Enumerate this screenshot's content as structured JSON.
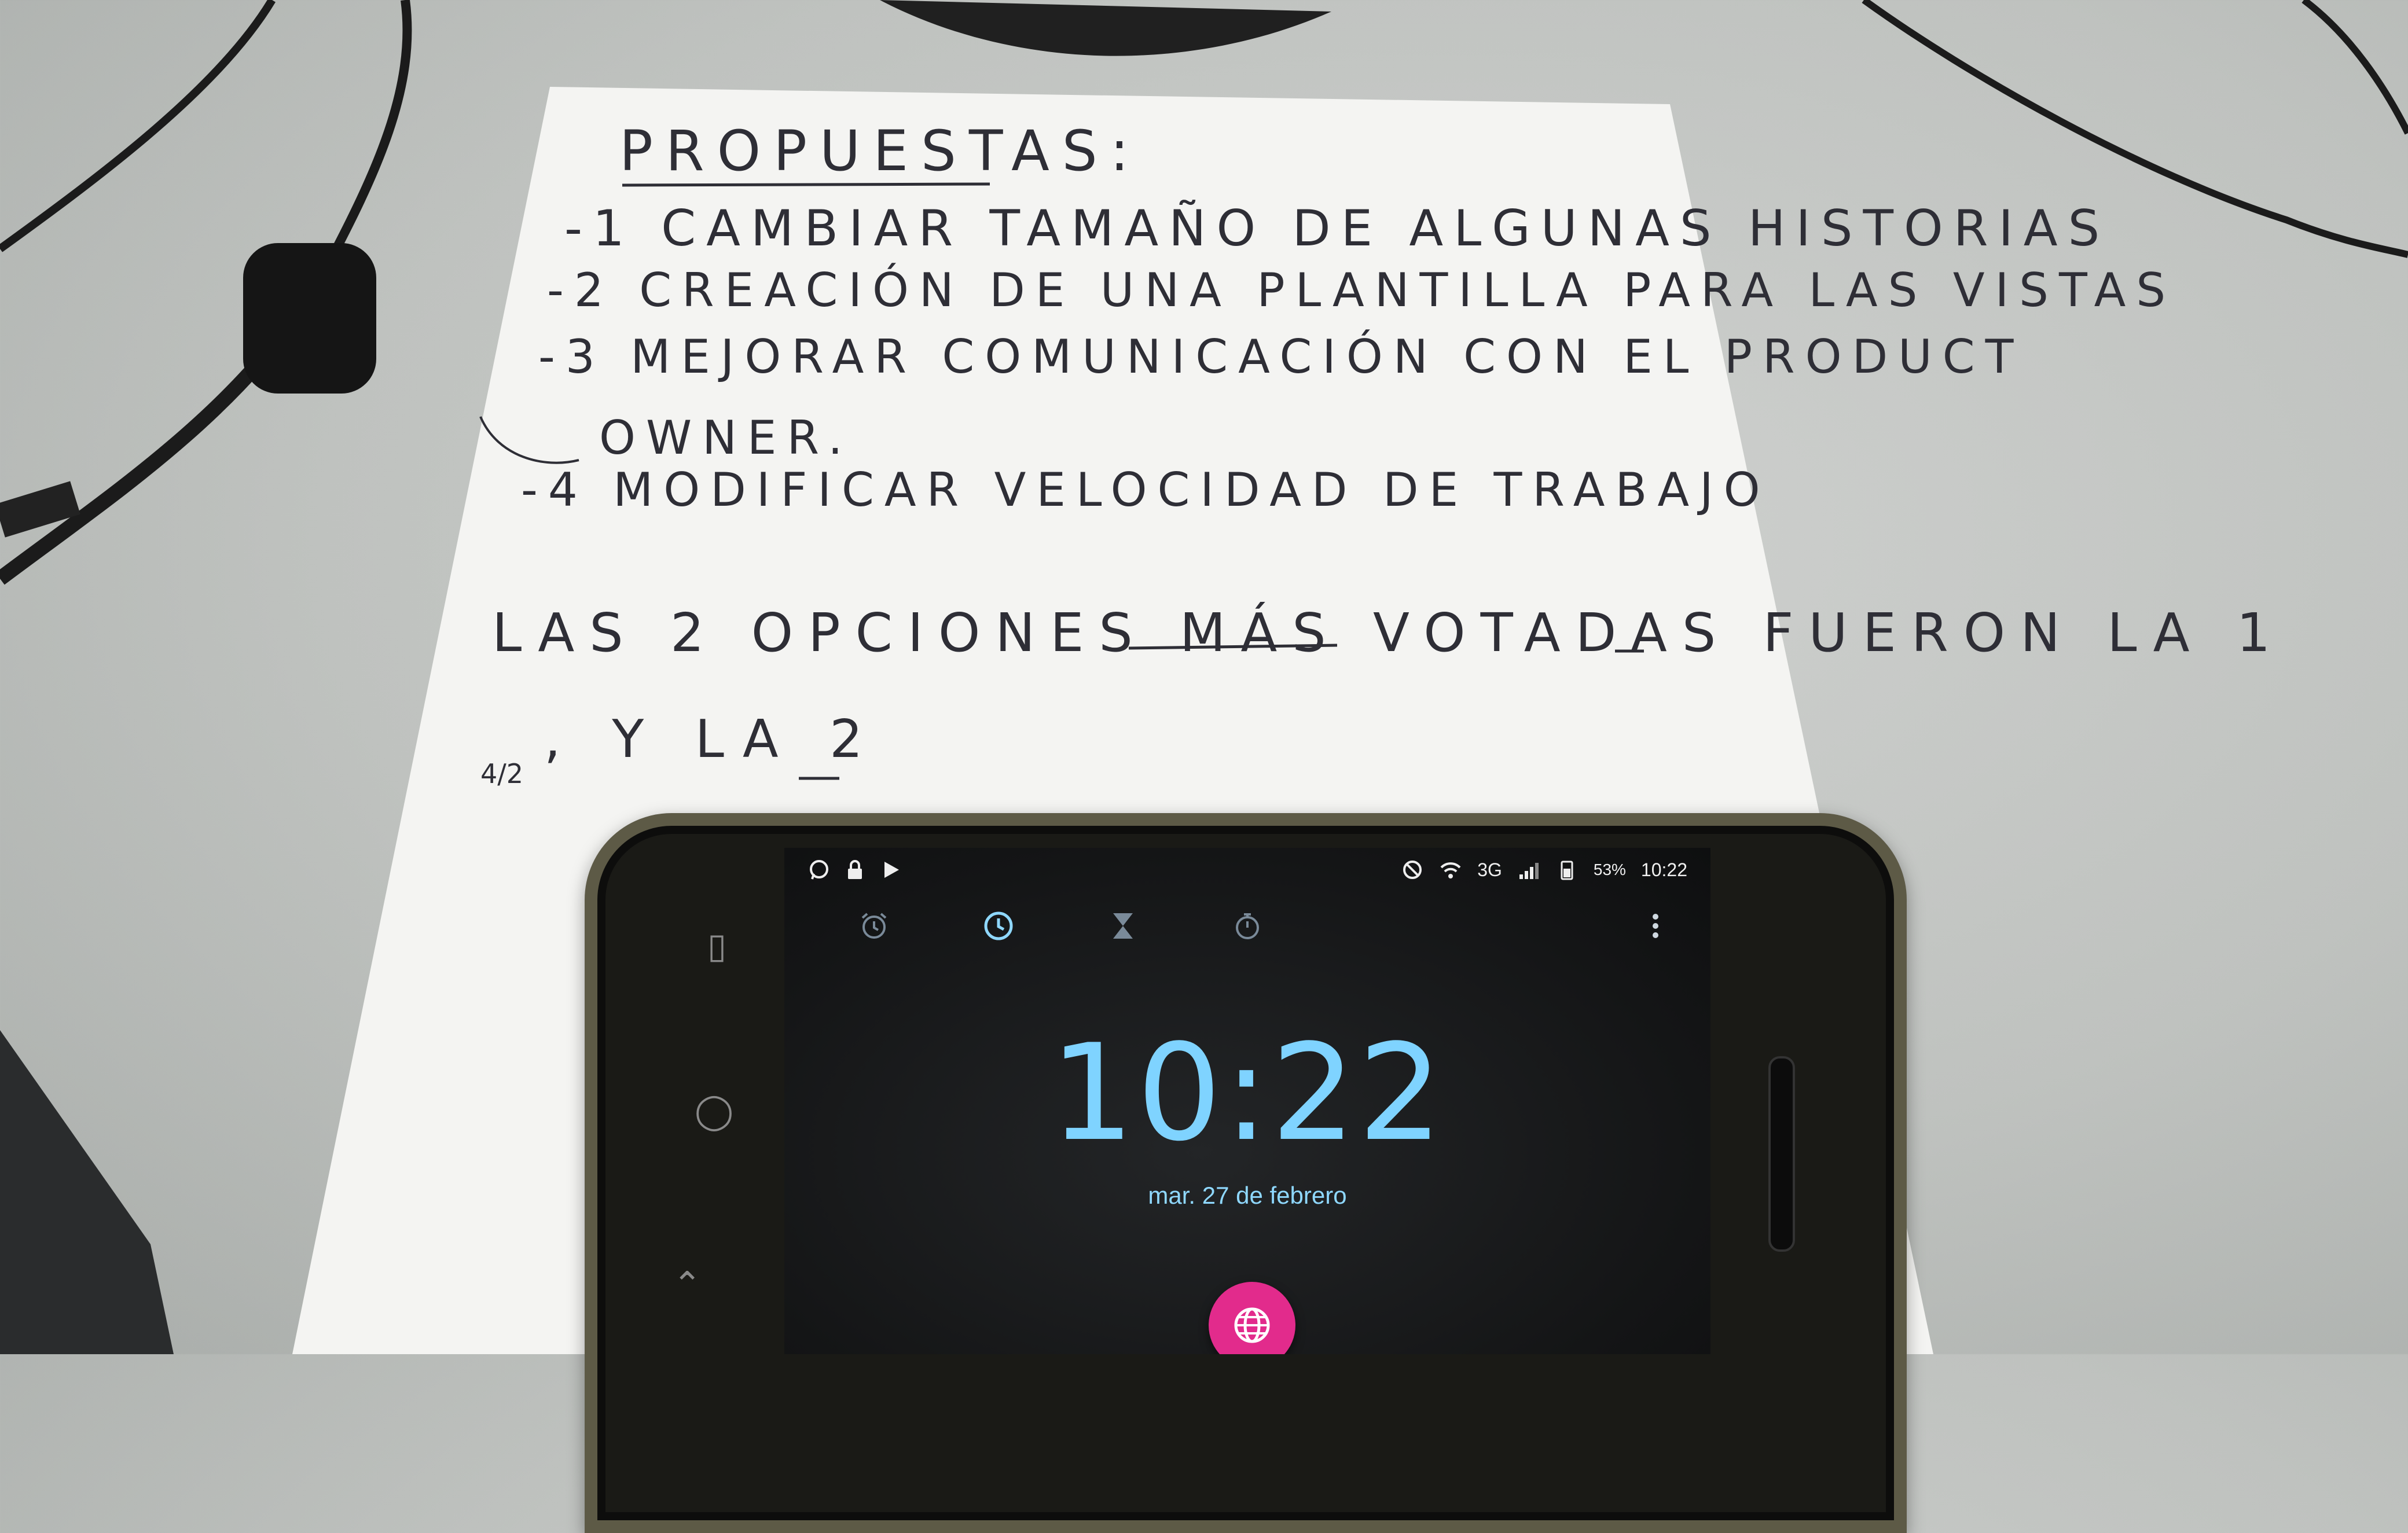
{
  "note": {
    "title": "PROPUESTAS:",
    "items": [
      "-1 CAMBIAR TAMAÑO DE ALGUNAS HISTORIAS",
      "-2 CREACIÓN DE UNA PLANTILLA PARA LAS VISTAS",
      "-3 MEJORAR COMUNICACIÓN CON EL PRODUCT",
      "OWNER.",
      "-4 MODIFICAR VELOCIDAD DE TRABAJO"
    ],
    "vote_line_1": "LAS 2 OPCIONES MÁS VOTADAS FUERON LA 1",
    "vote_line_2": ", Y LA 2",
    "margin_mark": "4/2"
  },
  "phone": {
    "status_bar": {
      "left_icons": [
        "whatsapp-icon",
        "lock-icon",
        "play-store-icon"
      ],
      "network": "3G",
      "battery": "53%",
      "time": "10:22"
    },
    "clock_app": {
      "tabs": [
        "alarm-tab",
        "clock-tab",
        "timer-tab",
        "stopwatch-tab"
      ],
      "active_tab": "clock-tab",
      "time": "10:22",
      "date": "mar. 27 de febrero"
    },
    "colors": {
      "accent": "#7fd3ff",
      "fab": "#e22b8c",
      "case": "#5d5a46"
    }
  }
}
